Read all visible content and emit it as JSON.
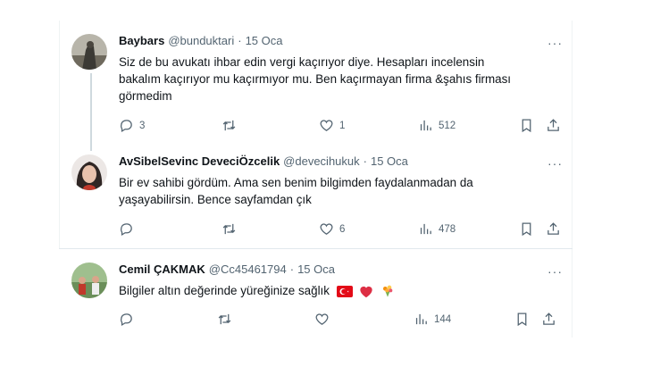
{
  "tweets": [
    {
      "name": "Baybars",
      "handle": "@bunduktari",
      "separator": "·",
      "date": "15 Oca",
      "text_lines": [
        "Siz de bu avukatı ihbar edin vergi kaçırıyor diye. Hesapları incelensin",
        "bakalım kaçırıyor mu kaçırmıyor mu. Ben kaçırmayan firma &şahıs firması",
        "görmedim"
      ],
      "replies": "3",
      "retweets": "",
      "likes": "1",
      "views": "512"
    },
    {
      "name": "AvSibelSevinc DeveciÖzcelik",
      "handle": "@devecihukuk",
      "separator": "·",
      "date": "15 Oca",
      "text_lines": [
        "Bir ev sahibi gördüm. Ama sen benim bilgimden faydalanmadan da",
        "yaşayabilirsin. Bence sayfamdan çık"
      ],
      "replies": "",
      "retweets": "",
      "likes": "6",
      "views": "478"
    },
    {
      "name": "Cemil ÇAKMAK",
      "handle": "@Cc45461794",
      "separator": "·",
      "date": "15 Oca",
      "text_lines": [
        "Bilgiler altın değerinde yüreğinize sağlık"
      ],
      "emoji": [
        "flag-turkey-icon",
        "red-heart-icon",
        "bouquet-icon"
      ],
      "replies": "",
      "retweets": "",
      "likes": "",
      "views": "144"
    }
  ],
  "more_label": "···",
  "colors": {
    "text": "#0f1419",
    "muted": "#536471",
    "border": "#eff3f4"
  }
}
